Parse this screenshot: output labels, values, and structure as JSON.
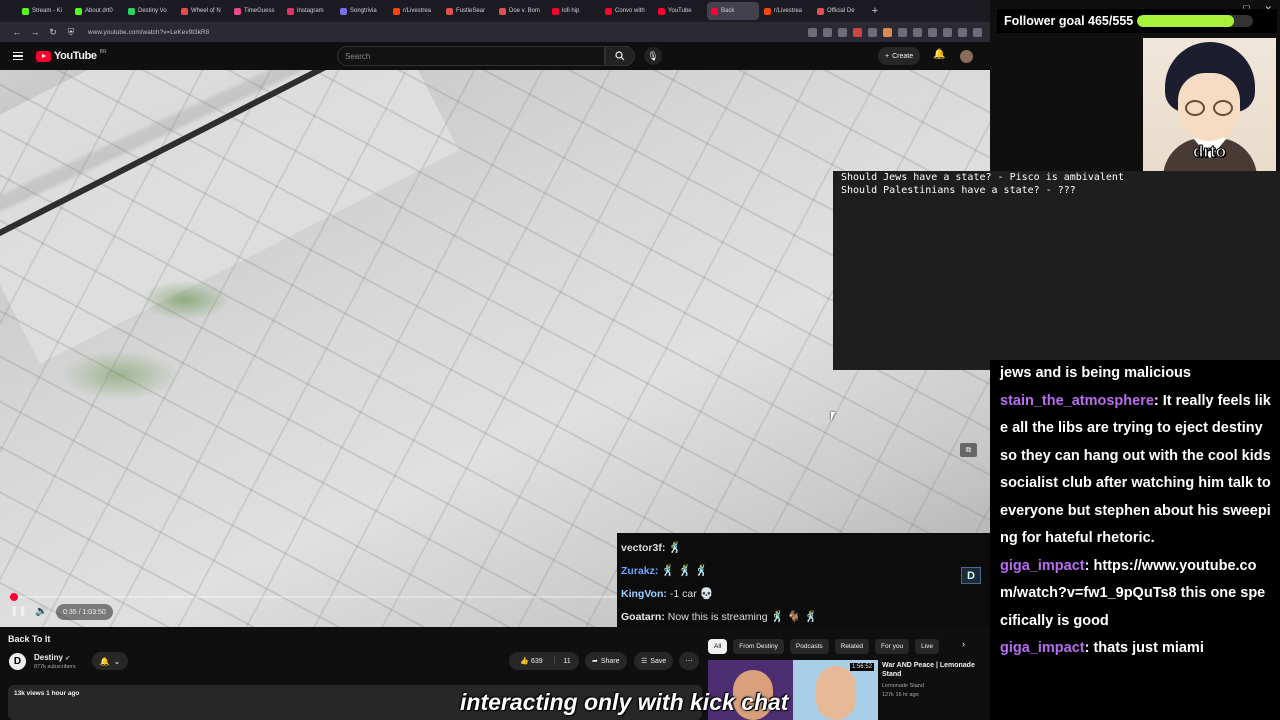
{
  "browser": {
    "tabs": [
      {
        "label": "Stream - Ki",
        "color": "#53fc18"
      },
      {
        "label": "About drt0",
        "color": "#53fc18"
      },
      {
        "label": "Destiny Vo",
        "color": "#2bd45e"
      },
      {
        "label": "Wheel of N",
        "color": "#e64a4a"
      },
      {
        "label": "TimeGuess",
        "color": "#e94b8a"
      },
      {
        "label": "Instagram",
        "color": "#e1306c"
      },
      {
        "label": "Songtrivia",
        "color": "#7a6cf0"
      },
      {
        "label": "r/Livestrea",
        "color": "#ff4500"
      },
      {
        "label": "FustleSear",
        "color": "#e05050"
      },
      {
        "label": "Doe v. Bom",
        "color": "#e05050"
      },
      {
        "label": "lofi hip",
        "color": "#ff0033"
      },
      {
        "label": "Convo with",
        "color": "#ff0033"
      },
      {
        "label": "YouTube",
        "color": "#ff0033"
      },
      {
        "label": "Back",
        "color": "#ff0033"
      },
      {
        "label": "r/Livestrea",
        "color": "#ff4500"
      },
      {
        "label": "Official De",
        "color": "#e05050"
      }
    ],
    "url": "www.youtube.com/watch?v=LeKev9t3kR8"
  },
  "youtube": {
    "search_placeholder": "Search",
    "create_label": "Create",
    "logo_text": "YouTube",
    "logo_country": "BR"
  },
  "player": {
    "progress": 0.006,
    "time": "0:35 / 1:03:50"
  },
  "overlay": {
    "lines": [
      "Should Jews have a state? - Pisco is ambivalent",
      "Should Palestinians have a state? - ???"
    ],
    "follower_goal": {
      "label": "Follower goal 465/555",
      "current": 465,
      "target": 555
    },
    "cam_name": "drto",
    "caption": "interacting only with kick chat",
    "kick_logo": "D"
  },
  "chat": {
    "messages": [
      {
        "user": "",
        "text": "jews and is being malicious"
      },
      {
        "user": "stain_the_atmosphere",
        "text": "It really feels like all the libs are trying to eject destiny so they can hang out with the cool kids socialist club after watching him talk to everyone but stephen about his sweeping for hateful rhetoric."
      },
      {
        "user": "giga_impact",
        "text": "https://www.youtube.com/watch?v=fw1_9pQuTs8 this one specifically is good"
      },
      {
        "user": "giga_impact",
        "text": "thats just miami"
      }
    ]
  },
  "kick_chat": {
    "messages": [
      {
        "user": "vector3f:",
        "text": ""
      },
      {
        "user": "Zurakz:",
        "text": ""
      },
      {
        "user": "KingVon:",
        "text": "-1 car"
      },
      {
        "user": "Goatarn:",
        "text": "Now this is streaming"
      }
    ]
  },
  "video_info": {
    "title": "Back To It",
    "channel": "Destiny",
    "subscribers": "877k subscribers",
    "likes": "639",
    "comments": "11",
    "share_label": "Share",
    "save_label": "Save",
    "views": "13k views  1 hour ago",
    "chips": [
      "All",
      "From Destiny",
      "Podcasts",
      "Related",
      "For you",
      "Live"
    ],
    "recommended": {
      "title": "War AND Peace | Lemonade Stand",
      "channel": "Lemonade Stand",
      "meta": "127k  16 hr ago",
      "badge": "1:56:52"
    }
  }
}
